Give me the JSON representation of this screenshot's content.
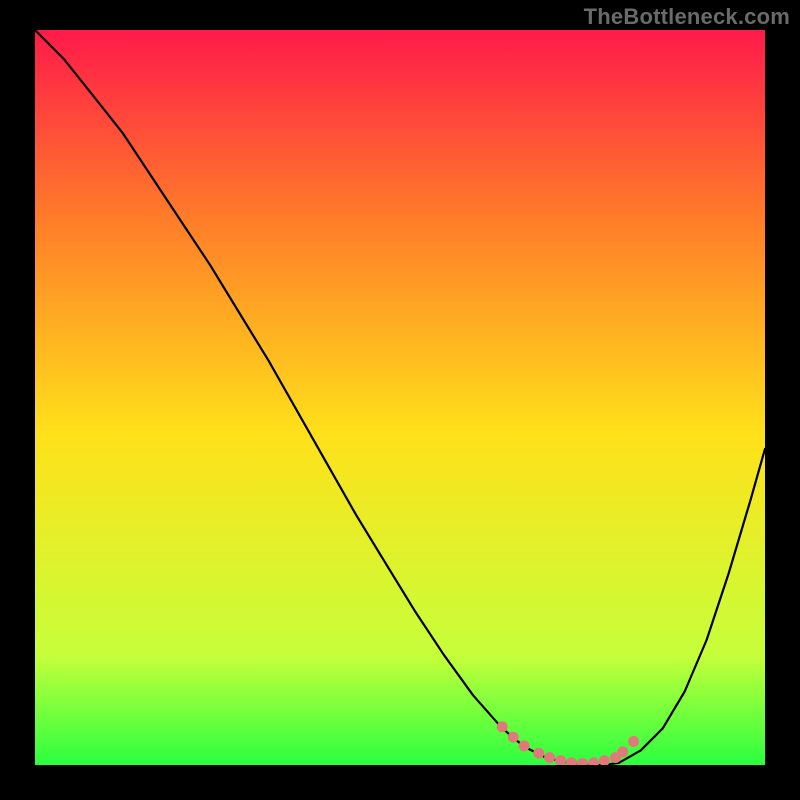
{
  "watermark": "TheBottleneck.com",
  "colors": {
    "gradient_top": "#ff1a4a",
    "gradient_mid": "#ffe11a",
    "gradient_bottom": "#2bff3f",
    "curve": "#000000",
    "dots": "#e07a7a",
    "frame": "#000000"
  },
  "chart_data": {
    "type": "line",
    "title": "",
    "xlabel": "",
    "ylabel": "",
    "xlim": [
      0,
      100
    ],
    "ylim": [
      0,
      100
    ],
    "series": [
      {
        "name": "curve",
        "x": [
          0,
          4,
          8,
          12,
          16,
          20,
          24,
          28,
          32,
          36,
          40,
          44,
          48,
          52,
          56,
          60,
          64,
          67,
          70,
          73,
          76,
          78,
          80,
          83,
          86,
          89,
          92,
          95,
          98,
          100
        ],
        "y": [
          100,
          96,
          91,
          86,
          80,
          74,
          68,
          61.5,
          55,
          48,
          41,
          34,
          27.5,
          21,
          15,
          9.5,
          5,
          2.5,
          1,
          0.3,
          0,
          0,
          0.3,
          2,
          5,
          10,
          17,
          26,
          36,
          43
        ]
      }
    ],
    "dots": {
      "name": "valley-dots",
      "x": [
        64,
        65.5,
        67,
        69,
        70.5,
        72,
        73.5,
        75,
        76.5,
        78,
        79.5,
        80.5,
        82
      ],
      "y": [
        5.2,
        3.8,
        2.6,
        1.6,
        1.0,
        0.6,
        0.3,
        0.2,
        0.3,
        0.6,
        1.0,
        1.8,
        3.2
      ]
    }
  }
}
